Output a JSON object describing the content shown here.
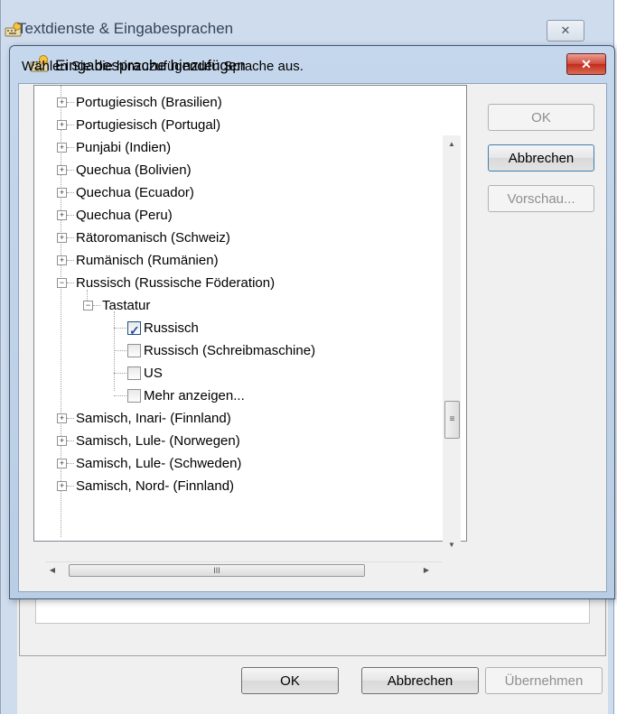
{
  "outer": {
    "title": "Textdienste & Eingabesprachen",
    "close_glyph": "✕",
    "buttons": {
      "ok": "OK",
      "cancel": "Abbrechen",
      "apply": "Übernehmen"
    }
  },
  "dialog": {
    "title": "Eingabesprache hinzufügen",
    "close_glyph": "✕",
    "prompt": "Wählen Sie die hinzuzufügenden Sprache aus.",
    "buttons": {
      "ok": "OK",
      "cancel": "Abbrechen",
      "preview": "Vorschau..."
    },
    "tree": {
      "items_before": [
        "Portugiesisch (Brasilien)",
        "Portugiesisch (Portugal)",
        "Punjabi (Indien)",
        "Quechua (Bolivien)",
        "Quechua (Ecuador)",
        "Quechua (Peru)",
        "Rätoromanisch (Schweiz)",
        "Rumänisch (Rumänien)"
      ],
      "expanded_item": "Russisch (Russische Föderation)",
      "sub_node": "Tastatur",
      "keyboards": [
        {
          "label": "Russisch",
          "checked": true
        },
        {
          "label": "Russisch (Schreibmaschine)",
          "checked": false
        },
        {
          "label": "US",
          "checked": false
        },
        {
          "label": "Mehr anzeigen...",
          "checked": false
        }
      ],
      "items_after": [
        "Samisch, Inari- (Finnland)",
        "Samisch, Lule- (Norwegen)",
        "Samisch, Lule- (Schweden)",
        "Samisch, Nord- (Finnland)"
      ]
    },
    "scroll_glyphs": {
      "up": "▲",
      "down": "▼",
      "left": "◀",
      "right": "▶",
      "grip_v": "≡",
      "grip_h": "III"
    }
  },
  "icons": [
    "keyboard-globe-icon",
    "plus-expander-icon",
    "minus-expander-icon",
    "checkmark-icon"
  ]
}
